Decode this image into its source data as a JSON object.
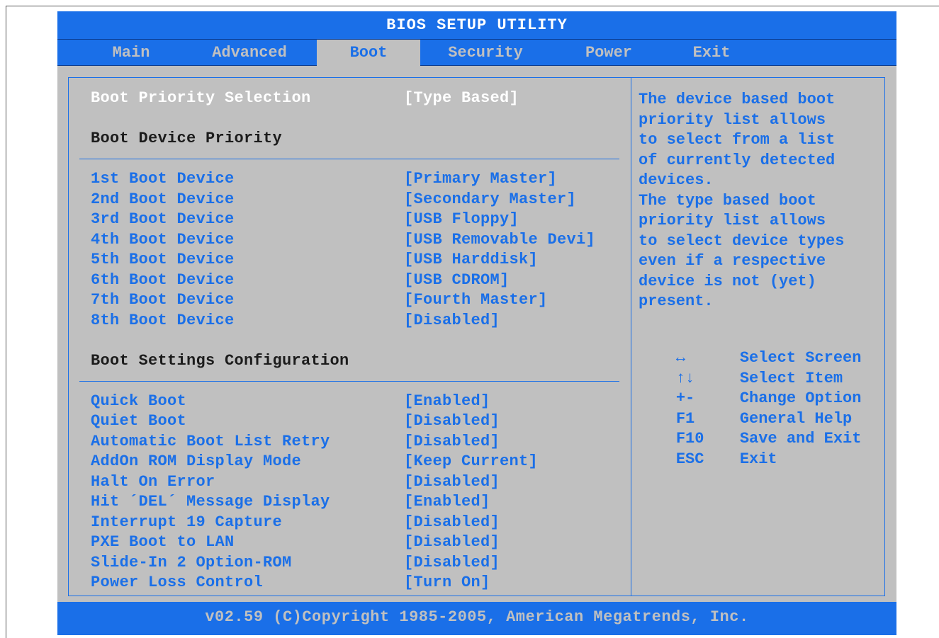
{
  "window": {
    "title": "BIOS SETUP UTILITY"
  },
  "tabs": [
    {
      "label": "Main"
    },
    {
      "label": "Advanced"
    },
    {
      "label": "Boot"
    },
    {
      "label": "Security"
    },
    {
      "label": "Power"
    },
    {
      "label": "Exit"
    }
  ],
  "active_tab": "Boot",
  "main": {
    "priority_selection": {
      "label": "Boot Priority Selection",
      "value": "[Type Based]"
    },
    "device_priority_heading": "Boot Device Priority",
    "boot_devices": [
      {
        "label": "1st Boot Device",
        "value": "[Primary Master]"
      },
      {
        "label": "2nd Boot Device",
        "value": "[Secondary Master]"
      },
      {
        "label": "3rd Boot Device",
        "value": "[USB Floppy]"
      },
      {
        "label": "4th Boot Device",
        "value": "[USB Removable Devi]"
      },
      {
        "label": "5th Boot Device",
        "value": "[USB Harddisk]"
      },
      {
        "label": "6th Boot Device",
        "value": "[USB CDROM]"
      },
      {
        "label": "7th Boot Device",
        "value": "[Fourth Master]"
      },
      {
        "label": "8th Boot Device",
        "value": "[Disabled]"
      }
    ],
    "settings_heading": "Boot Settings Configuration",
    "settings": [
      {
        "label": "Quick Boot",
        "value": "[Enabled]"
      },
      {
        "label": "Quiet Boot",
        "value": "[Disabled]"
      },
      {
        "label": "Automatic Boot List Retry",
        "value": "[Disabled]"
      },
      {
        "label": "AddOn ROM Display Mode",
        "value": "[Keep Current]"
      },
      {
        "label": "Halt On Error",
        "value": "[Disabled]"
      },
      {
        "label": "Hit ´DEL´ Message Display",
        "value": "[Enabled]"
      },
      {
        "label": "Interrupt 19 Capture",
        "value": "[Disabled]"
      },
      {
        "label": "PXE Boot to LAN",
        "value": "[Disabled]"
      },
      {
        "label": "Slide-In 2 Option-ROM",
        "value": "[Disabled]"
      },
      {
        "label": "Power Loss Control",
        "value": "[Turn On]"
      }
    ]
  },
  "help": {
    "lines": [
      "The device based boot",
      "priority list allows",
      "to select from a list",
      "of currently detected",
      "devices.",
      "The type based boot",
      "priority list allows",
      "to select device types",
      "even if a respective",
      "device is not (yet)",
      "present."
    ],
    "keys": [
      {
        "key": "↔",
        "action": "Select Screen"
      },
      {
        "key": "↑↓",
        "action": "Select Item"
      },
      {
        "key": "+-",
        "action": "Change Option"
      },
      {
        "key": "F1",
        "action": "General Help"
      },
      {
        "key": "F10",
        "action": "Save and Exit"
      },
      {
        "key": "ESC",
        "action": "Exit"
      }
    ]
  },
  "footer": {
    "text": "v02.59 (C)Copyright 1985-2005, American Megatrends, Inc."
  },
  "colors": {
    "accent_blue": "#1a6fe8",
    "panel_gray": "#c0c0c0",
    "highlight_white": "#ffffff"
  }
}
